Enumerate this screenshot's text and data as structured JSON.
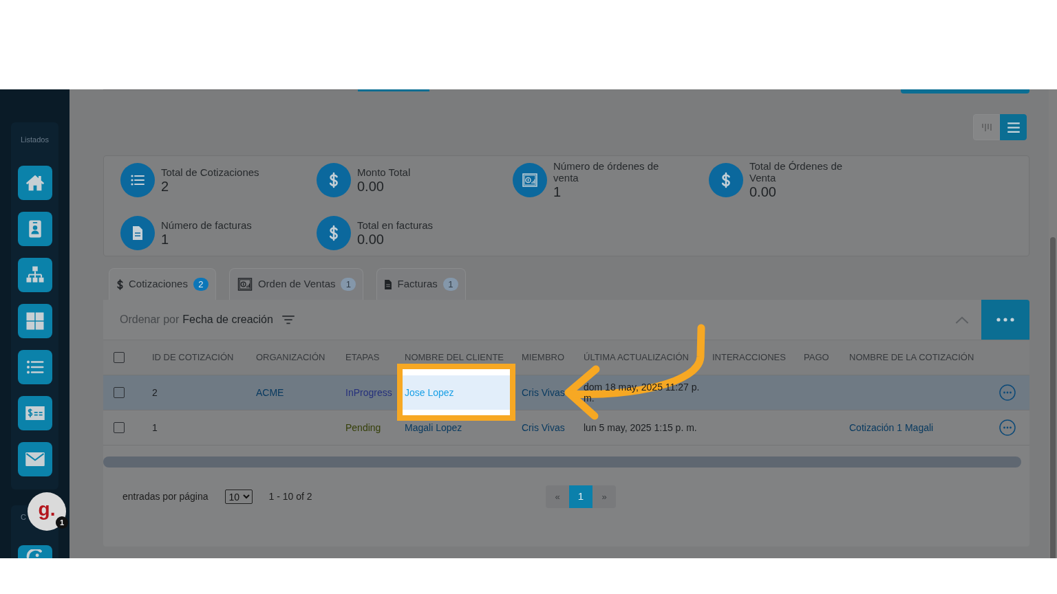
{
  "sidebar": {
    "sections": [
      {
        "label": "Listados",
        "buttons": [
          {
            "kind": "home"
          },
          {
            "kind": "contact"
          },
          {
            "kind": "hierarchy"
          },
          {
            "kind": "grid"
          },
          {
            "kind": "list"
          },
          {
            "kind": "invoice"
          },
          {
            "kind": "mail"
          }
        ]
      },
      {
        "label": "C",
        "buttons": [
          {
            "kind": "arc"
          }
        ]
      }
    ]
  },
  "chat_widget": {
    "logo": "g.",
    "badge": "1"
  },
  "view_toggle": [
    {
      "kind": "columns",
      "selected": false
    },
    {
      "kind": "list",
      "selected": true
    }
  ],
  "stats": [
    {
      "kind": "list",
      "label": "Total de Cotizaciones",
      "value": "2"
    },
    {
      "kind": "dollar",
      "label": "Monto Total",
      "value": "0.00"
    },
    {
      "kind": "chart",
      "label": "Número de órdenes de venta",
      "value": "1"
    },
    {
      "kind": "dollar",
      "label": "Total de Órdenes de Venta",
      "value": "0.00"
    },
    {
      "kind": "document",
      "label": "Número de facturas",
      "value": "1"
    },
    {
      "kind": "dollar",
      "label": "Total en facturas",
      "value": "0.00"
    }
  ],
  "tabs": [
    {
      "kind": "dollar",
      "label": "Cotizaciones",
      "count": "2",
      "selected": true
    },
    {
      "kind": "chart",
      "label": "Orden de Ventas",
      "count": "1",
      "selected": false
    },
    {
      "kind": "document",
      "label": "Facturas",
      "count": "1",
      "selected": false
    }
  ],
  "sort": {
    "label": "Ordenar por",
    "field": "Fecha de creación"
  },
  "table": {
    "select_all": {
      "checked": false
    },
    "columns": [
      "ID DE COTIZACIÓN",
      "ORGANIZACIÓN",
      "ETAPAS",
      "NOMBRE DEL CLIENTE",
      "MIEMBRO",
      "ÚLTIMA ACTUALIZACIÓN",
      "INTERACCIONES",
      "PAGO",
      "NOMBRE DE LA COTIZACIÓN"
    ],
    "rows": [
      {
        "selected": true,
        "checked": false,
        "id": "2",
        "organization": "ACME",
        "stage": {
          "text": "InProgress",
          "color": "#25307c"
        },
        "client": "Jose Lopez",
        "spotlight": true,
        "member": "Cris Vivas",
        "updated": "dom 18 may, 2025 11:27 p. m."
      },
      {
        "selected": false,
        "checked": false,
        "id": "1",
        "stage": {
          "text": "Pending",
          "color": "#353f08"
        },
        "client": "Magali Lopez",
        "spotlight": false,
        "member": "Cris Vivas",
        "updated": "lun 5 may, 2025 1:15 p. m.",
        "quote_name": "Cotización 1 Magali"
      }
    ]
  },
  "footer": {
    "per_page_label": "entradas por página",
    "per_page": "10",
    "range": "1 - 10 of 2",
    "pages": [
      {
        "label": "«",
        "selected": false
      },
      {
        "label": "1",
        "selected": true
      },
      {
        "label": "»",
        "selected": false
      }
    ]
  }
}
